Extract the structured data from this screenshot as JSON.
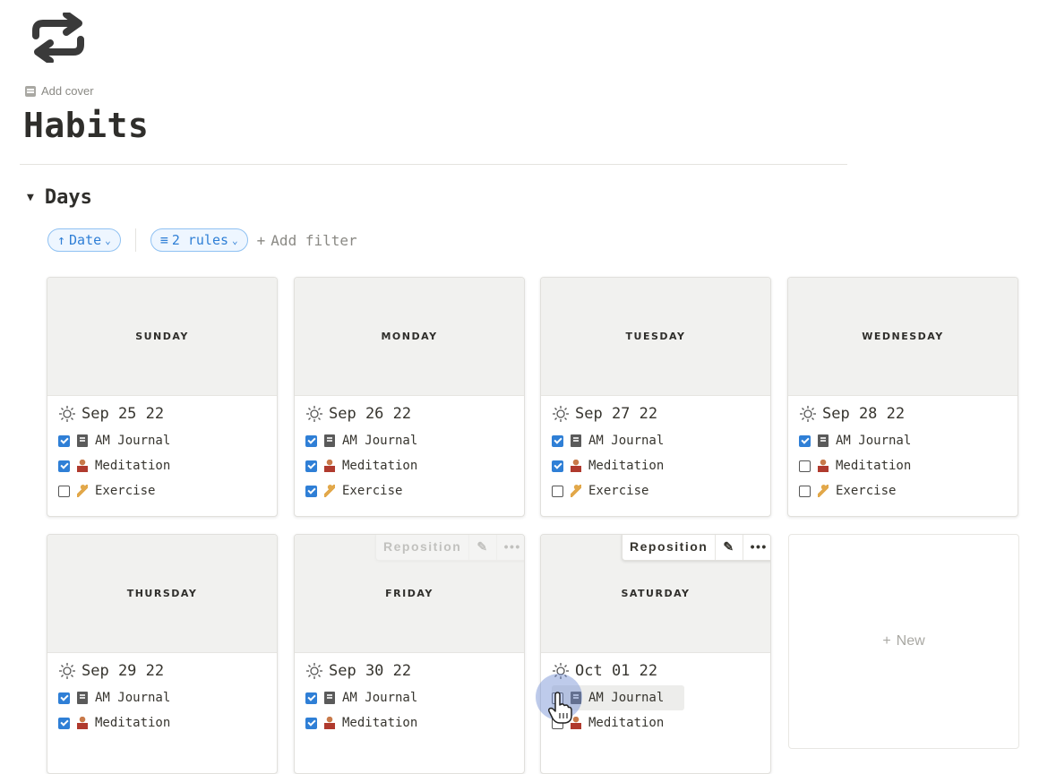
{
  "page": {
    "icon": "repeat-icon",
    "add_cover": "Add cover",
    "title": "Habits"
  },
  "section": {
    "title": "Days"
  },
  "filters": {
    "sort": {
      "label": "Date",
      "icon": "arrow-up-icon"
    },
    "rules": {
      "label": "2 rules",
      "icon": "filter-lines-icon"
    },
    "add_filter": "Add filter"
  },
  "cards": [
    {
      "day": "SUNDAY",
      "date": "Sep 25 22",
      "items": [
        {
          "label": "AM Journal",
          "checked": true,
          "icon": "journal-icon"
        },
        {
          "label": "Meditation",
          "checked": true,
          "icon": "meditation-icon"
        },
        {
          "label": "Exercise",
          "checked": false,
          "icon": "exercise-icon"
        }
      ]
    },
    {
      "day": "MONDAY",
      "date": "Sep 26 22",
      "items": [
        {
          "label": "AM Journal",
          "checked": true,
          "icon": "journal-icon"
        },
        {
          "label": "Meditation",
          "checked": true,
          "icon": "meditation-icon"
        },
        {
          "label": "Exercise",
          "checked": true,
          "icon": "exercise-icon"
        }
      ]
    },
    {
      "day": "TUESDAY",
      "date": "Sep 27 22",
      "items": [
        {
          "label": "AM Journal",
          "checked": true,
          "icon": "journal-icon"
        },
        {
          "label": "Meditation",
          "checked": true,
          "icon": "meditation-icon"
        },
        {
          "label": "Exercise",
          "checked": false,
          "icon": "exercise-icon"
        }
      ]
    },
    {
      "day": "WEDNESDAY",
      "date": "Sep 28 22",
      "items": [
        {
          "label": "AM Journal",
          "checked": true,
          "icon": "journal-icon"
        },
        {
          "label": "Meditation",
          "checked": false,
          "icon": "meditation-icon"
        },
        {
          "label": "Exercise",
          "checked": false,
          "icon": "exercise-icon"
        }
      ]
    },
    {
      "day": "THURSDAY",
      "date": "Sep 29 22",
      "items": [
        {
          "label": "AM Journal",
          "checked": true,
          "icon": "journal-icon"
        },
        {
          "label": "Meditation",
          "checked": true,
          "icon": "meditation-icon"
        }
      ]
    },
    {
      "day": "FRIDAY",
      "date": "Sep 30 22",
      "items": [
        {
          "label": "AM Journal",
          "checked": true,
          "icon": "journal-icon"
        },
        {
          "label": "Meditation",
          "checked": true,
          "icon": "meditation-icon"
        }
      ]
    },
    {
      "day": "SATURDAY",
      "date": "Oct 01 22",
      "items": [
        {
          "label": "AM Journal",
          "checked": false,
          "icon": "journal-icon"
        },
        {
          "label": "Meditation",
          "checked": false,
          "icon": "meditation-icon"
        }
      ]
    }
  ],
  "card_toolbar": {
    "reposition": "Reposition",
    "edit_icon": "pencil-icon",
    "more_icon": "more-icon"
  },
  "new_card": {
    "label": "New"
  },
  "colors": {
    "accent": "#2f7fd6",
    "pill_border": "#8fc1f2",
    "cover_bg": "#f1f1ef"
  }
}
